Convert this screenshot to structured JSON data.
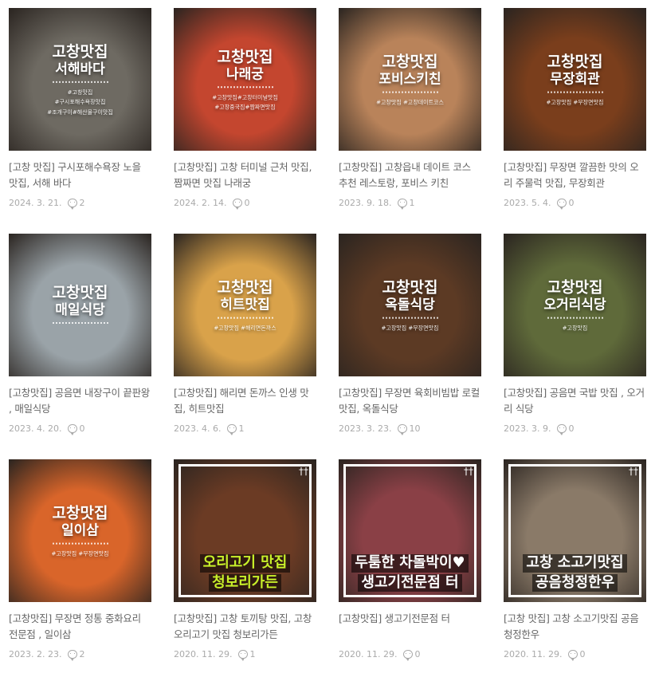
{
  "posts": [
    {
      "title": "[고창 맛집] 구시포해수욕장 노을 맛집, 서해 바다",
      "date": "2024. 3. 21.",
      "comments": "2",
      "overlay": [
        "고창맛집",
        "서해바다"
      ],
      "tags": [
        "#고창맛집",
        "#구시포해수욕장맛집",
        "#조개구이#해산물구이맛집"
      ],
      "bg": "#6e6a62"
    },
    {
      "title": "[고창맛집] 고창 터미널 근처 맛집, 짬짜면 맛집 나래궁",
      "date": "2024. 2. 14.",
      "comments": "0",
      "overlay": [
        "고창맛집",
        "나래궁"
      ],
      "tags": [
        "#고창맛집#고창터미널맛집",
        "#고창중국집#짬짜면맛집"
      ],
      "bg": "#c4462f"
    },
    {
      "title": "[고창맛집] 고창읍내 데이트 코스 추천 레스토랑, 포비스 키친",
      "date": "2023. 9. 18.",
      "comments": "1",
      "overlay": [
        "고창맛집",
        "포비스키친"
      ],
      "tags": [
        "#고창맛집 #고창데이트코스"
      ],
      "bg": "#b9835a"
    },
    {
      "title": "[고창맛집] 무장면 깔끔한 맛의 오리 주물럭 맛집, 무장회관",
      "date": "2023. 5. 4.",
      "comments": "0",
      "overlay": [
        "고창맛집",
        "무장회관"
      ],
      "tags": [
        "#고창맛집 #무장면맛집"
      ],
      "bg": "#7a3e1c"
    },
    {
      "title": "[고창맛집] 공음면 내장구이 끝판왕 , 매일식당",
      "date": "2023. 4. 20.",
      "comments": "0",
      "overlay": [
        "고창맛집",
        "매일식당"
      ],
      "tags": [],
      "bg": "#9aa3a8"
    },
    {
      "title": "[고창맛집] 해리면 돈까스 인생 맛집, 히트맛집",
      "date": "2023. 4. 6.",
      "comments": "1",
      "overlay": [
        "고창맛집",
        "히트맛집"
      ],
      "tags": [
        "#고창맛집 #해리면돈까스"
      ],
      "bg": "#d9a24a"
    },
    {
      "title": "[고창맛집] 무장면 육회비빔밥 로컬 맛집, 옥돌식당",
      "date": "2023. 3. 23.",
      "comments": "10",
      "overlay": [
        "고창맛집",
        "옥돌식당"
      ],
      "tags": [
        "#고창맛집 #무장면맛집"
      ],
      "bg": "#5c3a24"
    },
    {
      "title": "[고창맛집] 공음면 국밥 맛집 , 오거리 식당",
      "date": "2023. 3. 9.",
      "comments": "0",
      "overlay": [
        "고창맛집",
        "오거리식당"
      ],
      "tags": [
        "#고창맛집"
      ],
      "bg": "#5f6a3a"
    },
    {
      "title": "[고창맛집] 무장면 정통 중화요리 전문점 , 일이삼",
      "date": "2023. 2. 23.",
      "comments": "2",
      "overlay": [
        "고창맛집",
        "일이삼"
      ],
      "tags": [
        "#고창맛집 #무장면맛집"
      ],
      "bg": "#d9652a"
    },
    {
      "title": "[고창맛집] 고창 토끼탕 맛집, 고창 오리고기 맛집 청보리가든",
      "date": "2020. 11. 29.",
      "comments": "1",
      "caption": [
        "오리고기 맛집",
        "청보리가든"
      ],
      "captionColor": "#c8f02a",
      "bg": "#6b3b24"
    },
    {
      "title": "[고창맛집] 생고기전문점 터",
      "date": "2020. 11. 29.",
      "comments": "0",
      "caption": [
        "두툼한 차돌박이♥",
        "생고기전문점 터"
      ],
      "captionColor": "#ffffff",
      "bg": "#8a4046"
    },
    {
      "title": "[고창 맛집] 고창 소고기맛집 공음청정한우",
      "date": "2020. 11. 29.",
      "comments": "0",
      "caption": [
        "고창 소고기맛집",
        "공음청정한우"
      ],
      "captionColor": "#ffffff",
      "bg": "#8a7a68"
    }
  ]
}
